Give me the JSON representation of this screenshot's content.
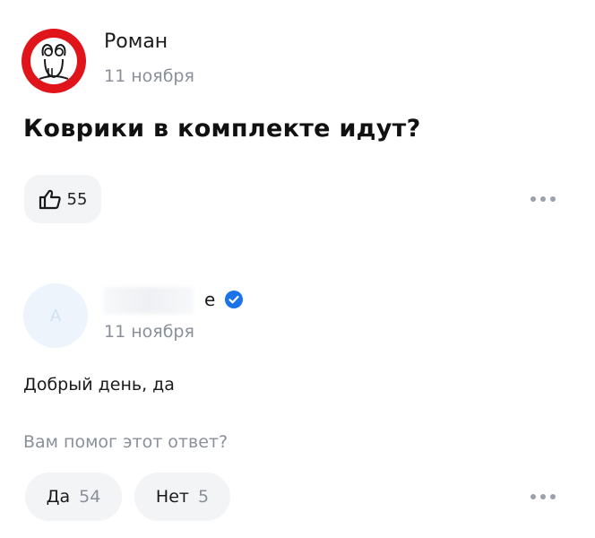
{
  "question": {
    "author": "Роман",
    "date": "11 ноября",
    "text": "Коврики в комплекте идут?",
    "likes": "55",
    "avatar_icon": "cat-logo-icon",
    "colors": {
      "avatar_bg": "#e0141b"
    }
  },
  "answer": {
    "author_visible": "е",
    "verified_icon": "verified-check-icon",
    "avatar_letter": "А",
    "date": "11 ноября",
    "text": "Добрый день, да",
    "helpful_prompt": "Вам помог этот ответ?",
    "vote_yes_label": "Да",
    "vote_yes_count": "54",
    "vote_no_label": "Нет",
    "vote_no_count": "5",
    "colors": {
      "verified": "#1a73e8"
    }
  },
  "icons": {
    "like": "thumbs-up-icon",
    "more": "more-dots-icon"
  }
}
